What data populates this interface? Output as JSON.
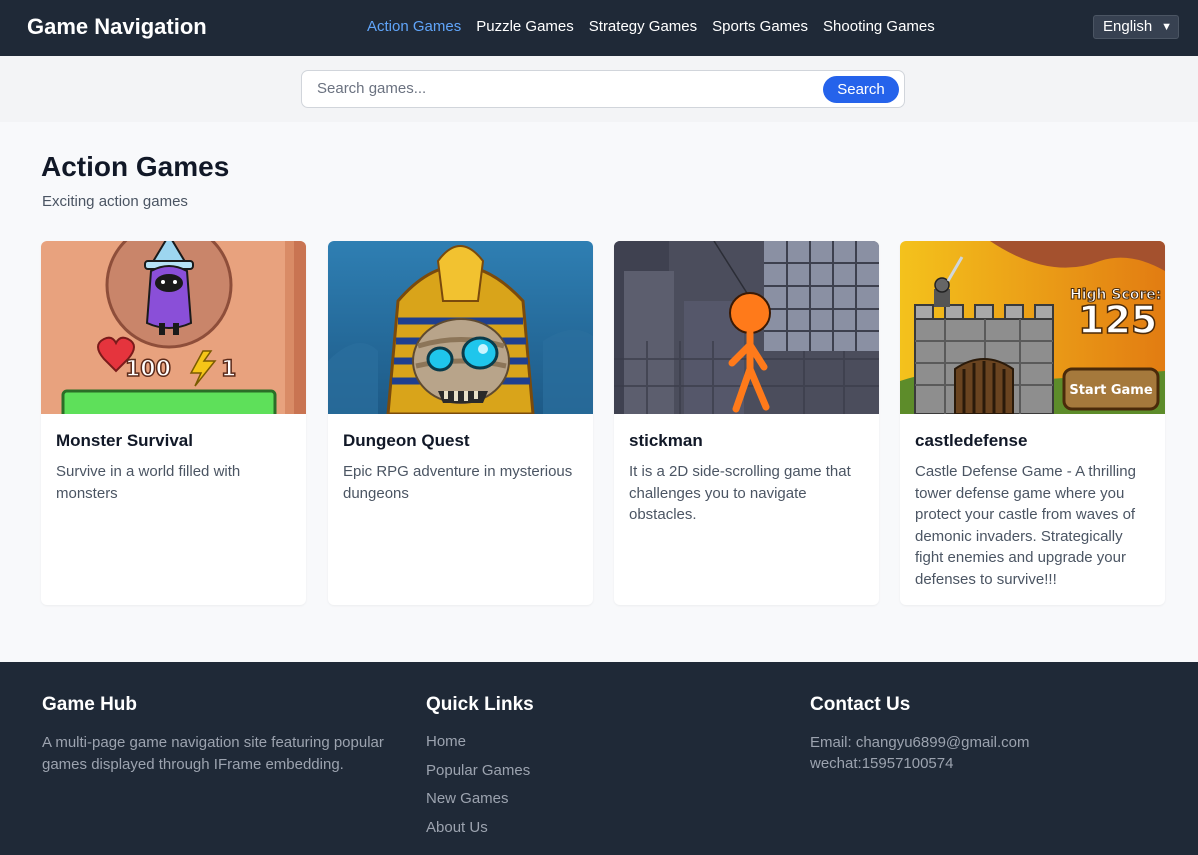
{
  "header": {
    "brand": "Game Navigation",
    "nav": [
      "Action Games",
      "Puzzle Games",
      "Strategy Games",
      "Sports Games",
      "Shooting Games"
    ],
    "language": "English"
  },
  "search": {
    "placeholder": "Search games...",
    "button": "Search"
  },
  "main": {
    "title": "Action Games",
    "subtitle": "Exciting action games",
    "games": [
      {
        "title": "Monster Survival",
        "description": "Survive in a world filled with monsters",
        "thumb_stats": [
          "100",
          "1"
        ]
      },
      {
        "title": "Dungeon Quest",
        "description": "Epic RPG adventure in mysterious dungeons"
      },
      {
        "title": "stickman",
        "description": "It is a 2D side-scrolling game that challenges you to navigate obstacles."
      },
      {
        "title": "castledefense",
        "description": "Castle Defense Game - A thrilling tower defense game where you protect your castle from waves of demonic invaders. Strategically fight enemies and upgrade your defenses to survive!!!",
        "thumb_score_label": "High Score:",
        "thumb_score": "125",
        "thumb_button": "Start Game"
      }
    ]
  },
  "footer": {
    "about": {
      "title": "Game Hub",
      "text": "A multi-page game navigation site featuring popular games displayed through IFrame embedding."
    },
    "links": {
      "title": "Quick Links",
      "items": [
        "Home",
        "Popular Games",
        "New Games",
        "About Us"
      ]
    },
    "contact": {
      "title": "Contact Us",
      "email": "Email: changyu6899@gmail.com",
      "wechat": "wechat:15957100574"
    }
  },
  "colors": {
    "header_bg": "#1f2937",
    "accent": "#2563eb",
    "active_nav": "#60a5fa"
  }
}
